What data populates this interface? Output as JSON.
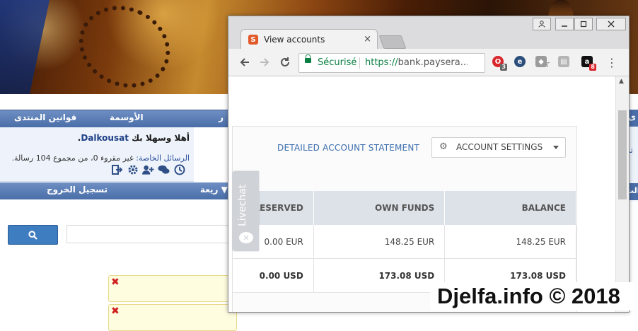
{
  "forum": {
    "nav_rules": "قوانين المنتدى",
    "nav_badges": "الأوسمة",
    "nav_partial_left": "ر",
    "welcome_prefix": "أهلا وسهلا بك",
    "username": "Dalkousat",
    "welcome_dot": ".",
    "pm_label": "الرسائل الخاصة:",
    "pm_status": "غير مقروء 0، من مجموع 104 رسالة.",
    "logout": "تسجيل الخروج",
    "quick_partial": "ريعة",
    "right_partial_top": "ى",
    "right_partial_mid": "تد",
    "right_partial_bottom": "الت",
    "icons": [
      "logout-icon",
      "gear-icon",
      "add-user-icon",
      "chat-icon",
      "clock-icon"
    ]
  },
  "window": {
    "controls": [
      "user-icon",
      "minimize-icon",
      "maximize-icon",
      "close-icon"
    ]
  },
  "tab": {
    "favicon": "S",
    "title": "View accounts",
    "close": "×"
  },
  "toolbar": {
    "secure_label": "Sécurisé",
    "url_protocol": "https://",
    "url_rest": "bank.paysera...",
    "ext_badge_1": "3",
    "ext_badge_2": "8",
    "ext_letter": "a"
  },
  "page": {
    "statement_link": "DETAILED ACCOUNT STATEMENT",
    "settings_label": "ACCOUNT SETTINGS",
    "livechat": "Livechat"
  },
  "accounts_table": {
    "headers": [
      "RESERVED",
      "OWN FUNDS",
      "BALANCE"
    ],
    "rows": [
      [
        "0.00 EUR",
        "148.25 EUR",
        "148.25 EUR"
      ],
      [
        "0.00 USD",
        "173.08 USD",
        "173.08 USD"
      ]
    ]
  },
  "watermark": "Djelfa.info © 2018",
  "colors": {
    "forum_nav": "#4a6ea8",
    "secure_green": "#0b8043",
    "link_blue": "#3a6db0",
    "table_header": "#dde2e8"
  }
}
